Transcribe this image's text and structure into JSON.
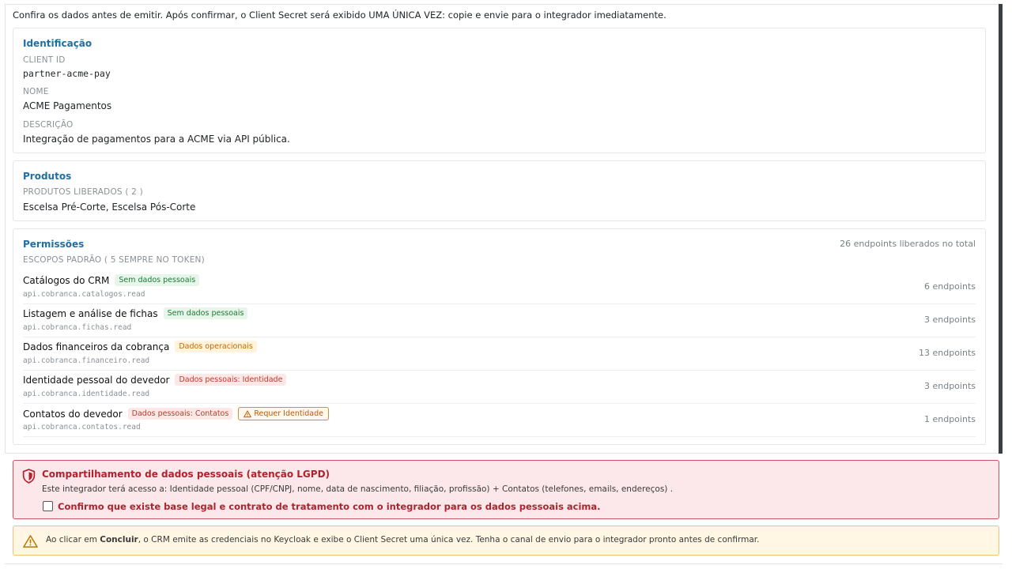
{
  "intro": "Confira os dados antes de emitir. Após confirmar, o Client Secret será exibido UMA ÚNICA VEZ: copie e envie para o integrador imediatamente.",
  "identificacao": {
    "title": "Identificação",
    "client_id_label": "CLIENT ID",
    "client_id": "partner-acme-pay",
    "nome_label": "NOME",
    "nome": "ACME Pagamentos",
    "descricao_label": "DESCRIÇÃO",
    "descricao": "Integração de pagamentos para a ACME via API pública."
  },
  "produtos": {
    "title": "Produtos",
    "label": "PRODUTOS LIBERADOS ( 2 )",
    "value": "Escelsa Pré-Corte, Escelsa Pós-Corte"
  },
  "permissoes": {
    "title": "Permissões",
    "total": "26  endpoints liberados no total",
    "default_scopes_label": "ESCOPOS PADRÃO ( 5  SEMPRE NO TOKEN)",
    "items": [
      {
        "name": "Catálogos do CRM",
        "scope": "api.cobranca.catalogos.read",
        "badge": "Sem dados pessoais",
        "count": "6 endpoints"
      },
      {
        "name": "Listagem e análise de fichas",
        "scope": "api.cobranca.fichas.read",
        "badge": "Sem dados pessoais",
        "count": "3 endpoints"
      },
      {
        "name": "Dados financeiros da cobrança",
        "scope": "api.cobranca.financeiro.read",
        "badge": "Dados operacionais",
        "count": "13 endpoints"
      },
      {
        "name": "Identidade pessoal do devedor",
        "scope": "api.cobranca.identidade.read",
        "badge": "Dados pessoais: Identidade",
        "count": "3 endpoints"
      },
      {
        "name": "Contatos do devedor",
        "scope": "api.cobranca.contatos.read",
        "badge": "Dados pessoais: Contatos",
        "extra_badge": "Requer Identidade",
        "count": "1 endpoints"
      }
    ]
  },
  "lgpd": {
    "title": "Compartilhamento de dados pessoais (atenção LGPD)",
    "text": "Este integrador terá acesso a: Identidade pessoal (CPF/CNPJ, nome, data de nascimento, filiação, profissão) + Contatos (telefones, emails, endereços) .",
    "checkbox_label": "Confirmo que existe base legal e contrato de tratamento com o integrador para os dados pessoais acima."
  },
  "warning": {
    "prefix": "Ao clicar em ",
    "action": "Concluir",
    "suffix": ", o CRM emite as credenciais no Keycloak e exibe o Client Secret uma única vez. Tenha o canal de envio para o integrador pronto antes de confirmar."
  },
  "colors": {
    "accent": "#1f6fa5",
    "danger": "#b0222e",
    "warning_bg": "#fff7e3",
    "danger_bg": "#fce8ea"
  }
}
